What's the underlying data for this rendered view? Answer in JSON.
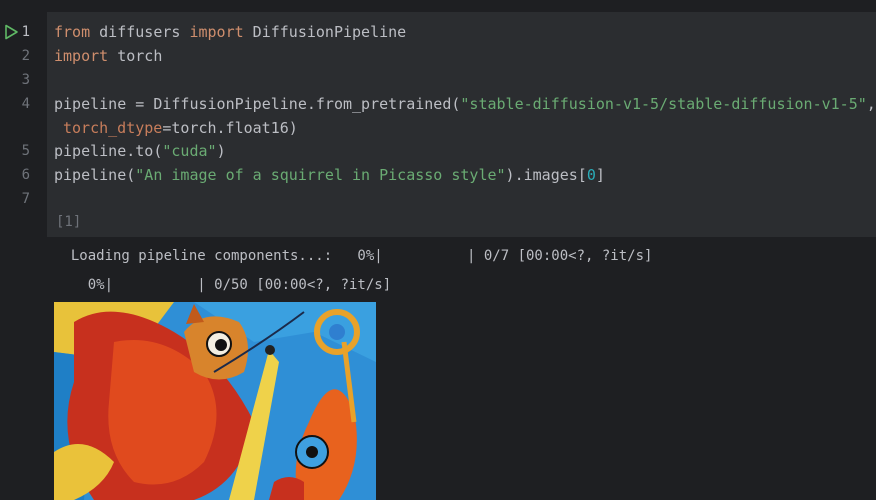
{
  "cell": {
    "line_numbers": [
      "1",
      "2",
      "3",
      "4",
      "5",
      "6",
      "7"
    ],
    "execution_count": "[1]",
    "code": {
      "l1_from": "from",
      "l1_mod": " diffusers ",
      "l1_import": "import",
      "l1_name": " DiffusionPipeline",
      "l2_import": "import",
      "l2_name": " torch",
      "l4_a": "pipeline = DiffusionPipeline.from_pretrained(",
      "l4_str": "\"stable-diffusion-v1-5/stable-diffusion-v1-5\"",
      "l4_end": ",",
      "l4c_param": "torch_dtype",
      "l4c_rest": "=torch.float16)",
      "l5_a": "pipeline.to(",
      "l5_str": "\"cuda\"",
      "l5_end": ")",
      "l6_a": "pipeline(",
      "l6_str": "\"An image of a squirrel in Picasso style\"",
      "l6_b": ").images[",
      "l6_num": "0",
      "l6_end": "]"
    }
  },
  "output": {
    "progress1": "  Loading pipeline components...:   0%|          | 0/7 [00:00<?, ?it/s]",
    "progress2": "    0%|          | 0/50 [00:00<?, ?it/s]"
  },
  "colors": {
    "background": "#1e1f22",
    "cell_background": "#2b2d30",
    "keyword": "#cf8e6d",
    "string": "#6aab73",
    "number": "#2aacb8",
    "run_icon": "#5fb865"
  },
  "icons": {
    "run": "run-cell-icon"
  }
}
